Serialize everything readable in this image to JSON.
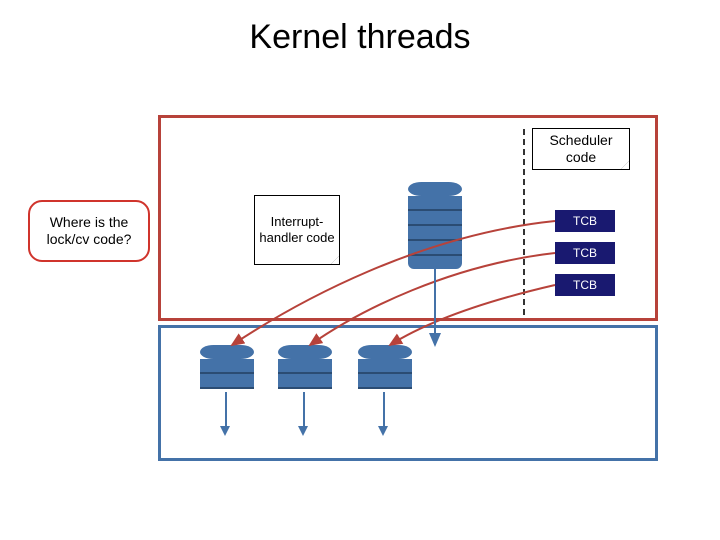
{
  "title": "Kernel threads",
  "callout_text": "Where is the lock/cv code?",
  "scheduler_note": "Scheduler code",
  "interrupt_note": "Interrupt-handler code",
  "tcb": {
    "a": "TCB",
    "b": "TCB",
    "c": "TCB"
  },
  "colors": {
    "kernel_border": "#b7423a",
    "user_border": "#4472a8",
    "stack_fill": "#4472a8",
    "tcb_fill": "#191970",
    "callout_border": "#d0342c"
  }
}
